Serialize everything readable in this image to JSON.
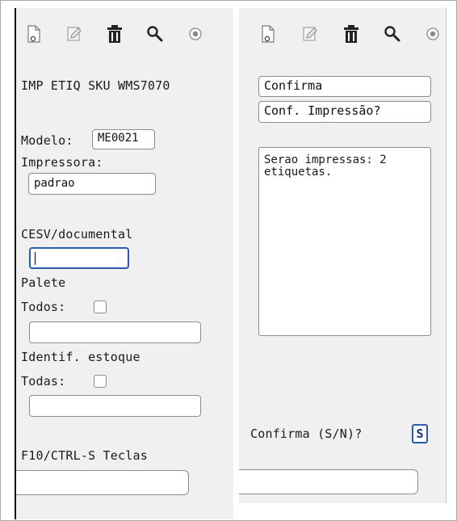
{
  "toolbar": {
    "icons": [
      "new-document-icon",
      "edit-icon",
      "trash-icon",
      "search-icon",
      "forward-circle-icon"
    ]
  },
  "left_panel": {
    "title": "IMP ETIQ SKU WMS7070",
    "modelo_label": "Modelo:",
    "modelo_value": "ME0021",
    "impressora_label": "Impressora:",
    "impressora_value": "padrao",
    "cesv_label": "CESV/documental",
    "cesv_value": "",
    "palete_label": "Palete",
    "todos_label": "Todos:",
    "palete_value": "",
    "identif_label": "Identif. estoque",
    "todas_label": "Todas:",
    "identif_value": "",
    "footer_label": "F10/CTRL-S Teclas",
    "footer_value": ""
  },
  "right_panel": {
    "confirma_title": "Confirma",
    "conf_impressao": "Conf. Impressão?",
    "message": "Serao impressas: 2\netiquetas.",
    "prompt_label": "Confirma (S/N)?",
    "prompt_value": "S",
    "footer_value": ""
  },
  "colors": {
    "panel_bg": "#f0f0f0",
    "focus_border": "#2a5aa8",
    "text": "#1a1a1a"
  }
}
